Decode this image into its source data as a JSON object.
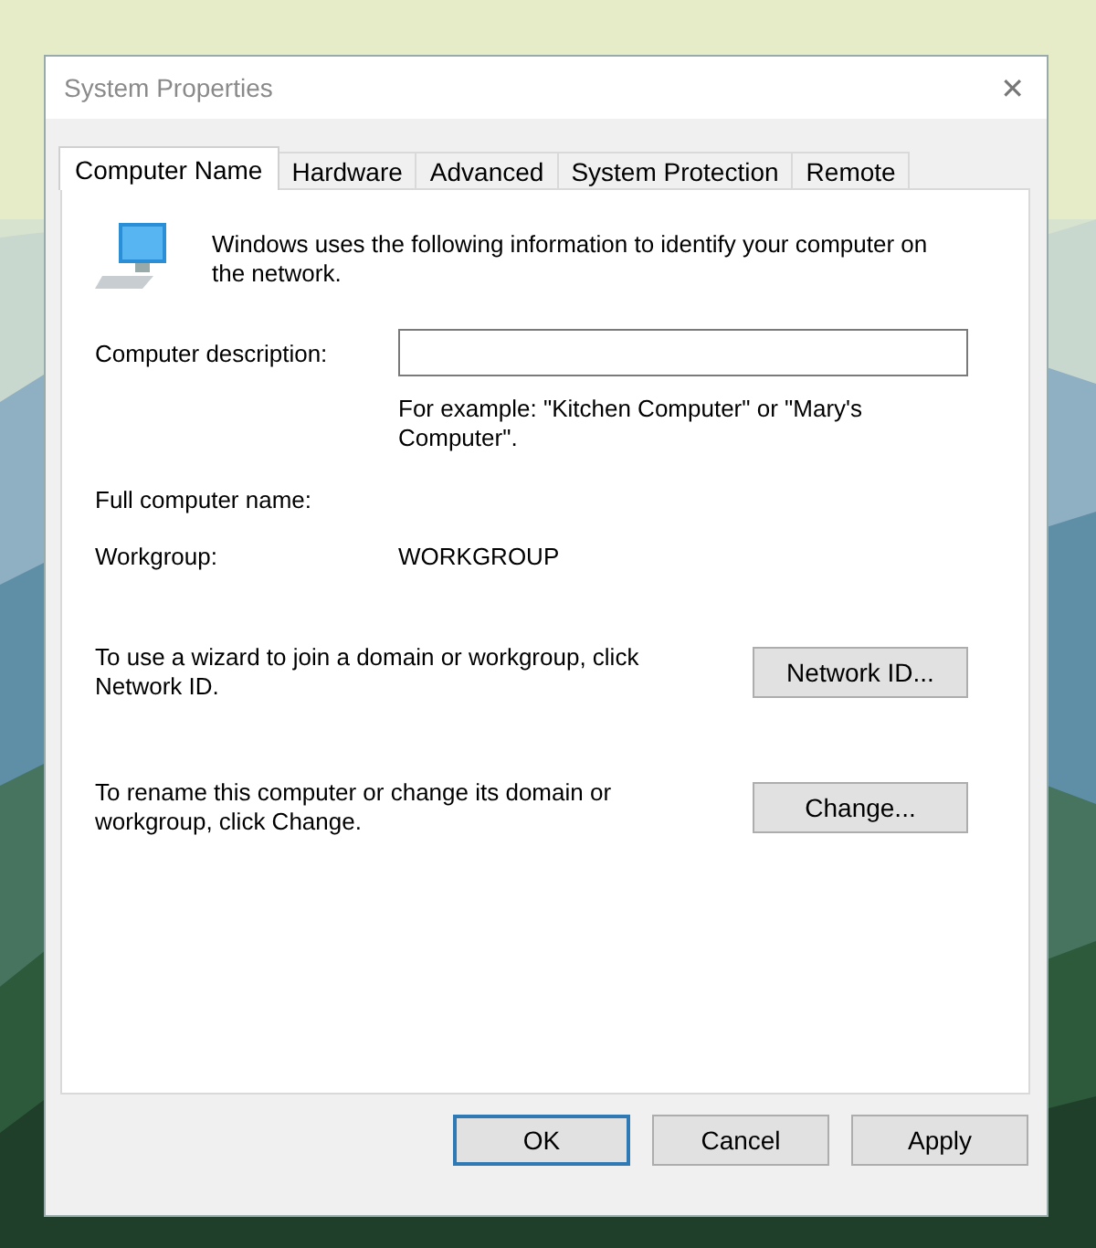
{
  "window": {
    "title": "System Properties",
    "close": "✕"
  },
  "tabs": [
    {
      "label": "Computer Name",
      "selected": true
    },
    {
      "label": "Hardware",
      "selected": false
    },
    {
      "label": "Advanced",
      "selected": false
    },
    {
      "label": "System Protection",
      "selected": false
    },
    {
      "label": "Remote",
      "selected": false
    }
  ],
  "intro": "Windows uses the following information to identify your computer on the network.",
  "description": {
    "label": "Computer description:",
    "hint": "For example: \"Kitchen Computer\" or \"Mary's Computer\"."
  },
  "full_name": {
    "label": "Full computer name:"
  },
  "workgroup": {
    "label": "Workgroup:",
    "value": "WORKGROUP"
  },
  "actions": [
    {
      "text": "To use a wizard to join a domain or workgroup, click Network ID.",
      "button": "Network ID..."
    },
    {
      "text": "To rename this computer or change its domain or workgroup, click Change.",
      "button": "Change..."
    }
  ],
  "buttons": [
    {
      "label": "OK",
      "default": true
    },
    {
      "label": "Cancel",
      "default": false
    },
    {
      "label": "Apply",
      "default": false
    }
  ]
}
